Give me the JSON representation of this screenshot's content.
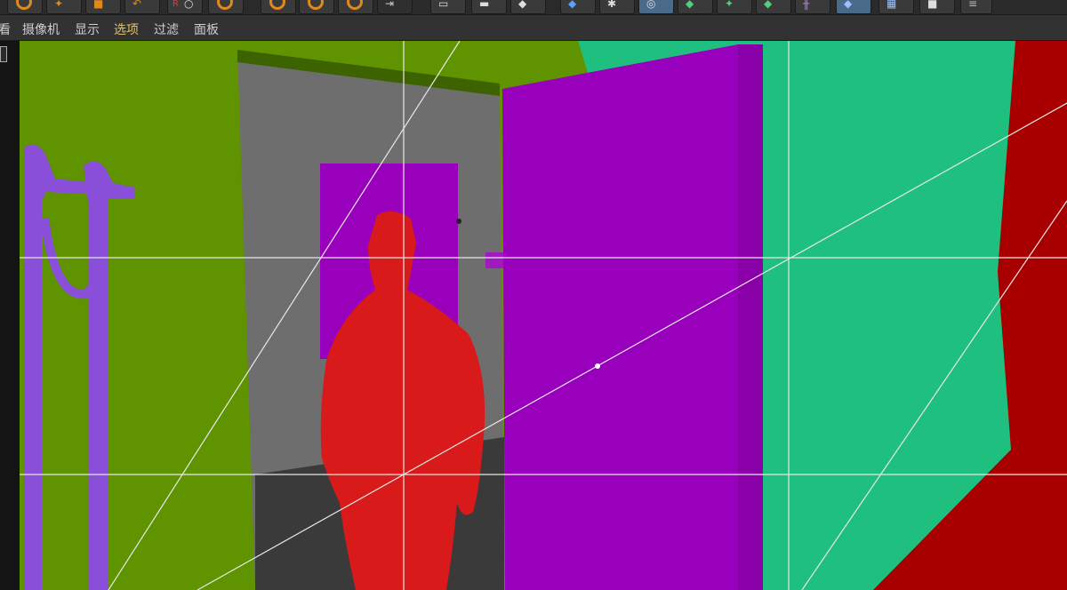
{
  "menu": {
    "items": [
      {
        "id": "view",
        "label": "看"
      },
      {
        "id": "camera",
        "label": "摄像机"
      },
      {
        "id": "display",
        "label": "显示"
      },
      {
        "id": "options",
        "label": "选项"
      },
      {
        "id": "filter",
        "label": "过滤"
      },
      {
        "id": "panel",
        "label": "面板"
      }
    ]
  },
  "toolbar": {
    "render_badge": "R",
    "icons": [
      "rotate-icon",
      "move-icon",
      "scale-icon",
      "undo-icon",
      "render-icon",
      "play-icon",
      "camera-ring-icon",
      "camera-ring-icon",
      "camera-ring-icon",
      "arrow-icon",
      "frame-icon",
      "view-icon",
      "object-icon",
      "cube-icon",
      "gizmo-icon",
      "select-icon",
      "green-cube-icon",
      "sphere-icon",
      "spline-icon",
      "cube-active-icon",
      "grid-icon",
      "camera-icon",
      "menu-icon"
    ]
  },
  "colors": {
    "green_wall": "#5f9300",
    "teal_wall": "#1fbf7f",
    "purple_door": "#9900bb",
    "red_figure": "#d81a1a",
    "dark_red": "#a80000",
    "lavender_prop": "#8a4fd8",
    "gray_hall": "#6e6e6e",
    "floor": "#3a3a3a",
    "guide_line": "#ffffff",
    "accent_menu": "#e3c36a"
  }
}
